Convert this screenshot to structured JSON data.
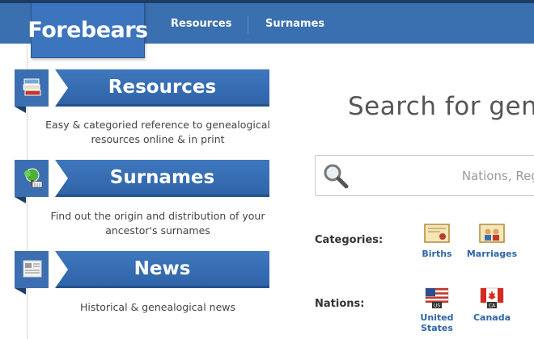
{
  "header": {
    "logo": "Forebears",
    "nav": [
      {
        "label": "Resources"
      },
      {
        "label": "Surnames"
      }
    ]
  },
  "sections": [
    {
      "title": "Resources",
      "icon": "books-icon",
      "description": "Easy & categoried reference to genealogical resources online & in print"
    },
    {
      "title": "Surnames",
      "icon": "family-tree-icon",
      "description": "Find out the origin and distribution of your ancestor's surnames"
    },
    {
      "title": "News",
      "icon": "newspaper-icon",
      "description": "Historical & genealogical news"
    }
  ],
  "search": {
    "title": "Search for gene",
    "placeholder": "Nations, Regi"
  },
  "categories": {
    "label": "Categories:",
    "items": [
      {
        "label": "Births",
        "icon": "certificate-icon"
      },
      {
        "label": "Marriages",
        "icon": "marriage-certificate-icon"
      }
    ]
  },
  "nations": {
    "label": "Nations:",
    "items": [
      {
        "label": "United States",
        "icon": "us-flag-icon",
        "badge": "US"
      },
      {
        "label": "Canada",
        "icon": "canada-flag-icon",
        "badge": "CA"
      }
    ]
  },
  "colors": {
    "brand": "#3a6fb0",
    "link": "#2d65a8"
  }
}
